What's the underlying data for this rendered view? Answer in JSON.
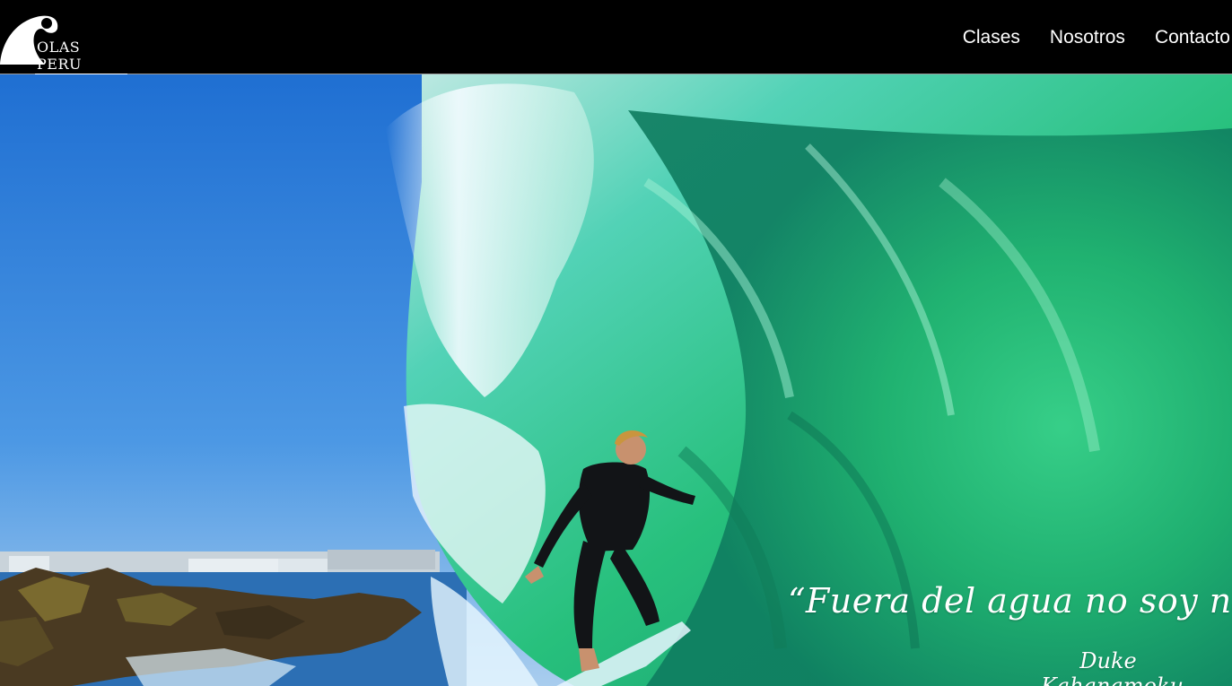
{
  "header": {
    "logo_text": "OLAS PERU",
    "nav": [
      {
        "label": "Clases"
      },
      {
        "label": "Nosotros"
      },
      {
        "label": "Contacto"
      }
    ]
  },
  "hero": {
    "image_icon": "surfer-in-wave-photo",
    "quote": "“Fuera del agua no soy nadie”",
    "author_line1": "Duke",
    "author_line2": "Kahanamoku"
  },
  "colors": {
    "header_bg": "#000000",
    "sky": "#2f7fd8",
    "wave_green": "#2fbf7a",
    "text": "#ffffff"
  }
}
